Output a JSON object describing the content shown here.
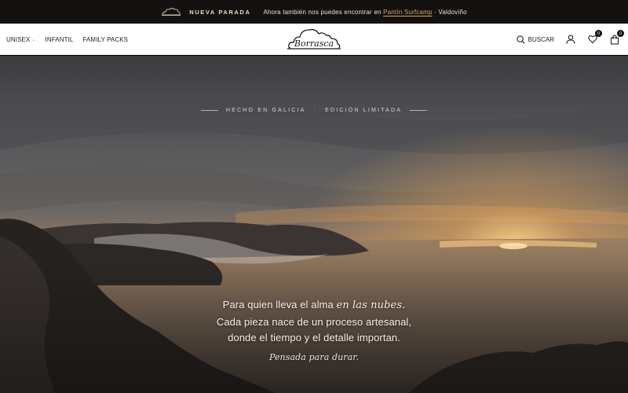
{
  "announcement": {
    "tag": "NUEVA PARADA",
    "message_before": "Ahora también nos puedes encontrar en",
    "message_link": "Pantín Surfcamp",
    "message_after": "· Valdoviño",
    "accent_color": "#d9a95a"
  },
  "nav": {
    "items": [
      {
        "label": "UNISEX"
      },
      {
        "label": "INFANTIL"
      },
      {
        "label": "FAMILY PACKS"
      }
    ]
  },
  "brand": {
    "name": "Borrasca"
  },
  "tools": {
    "search_label": "BUSCAR",
    "wishlist_count": "0",
    "cart_count": "0"
  },
  "hero": {
    "eyebrow_left": "HECHO EN GALICIA",
    "eyebrow_right": "EDICIÓN LIMITADA",
    "line1_before": "Para quien lleva el alma",
    "line1_em": "en las nubes.",
    "line2": "Cada pieza nace de un proceso artesanal,",
    "line3": "donde el tiempo y el detalle importan.",
    "signature": "Pensada para durar."
  }
}
